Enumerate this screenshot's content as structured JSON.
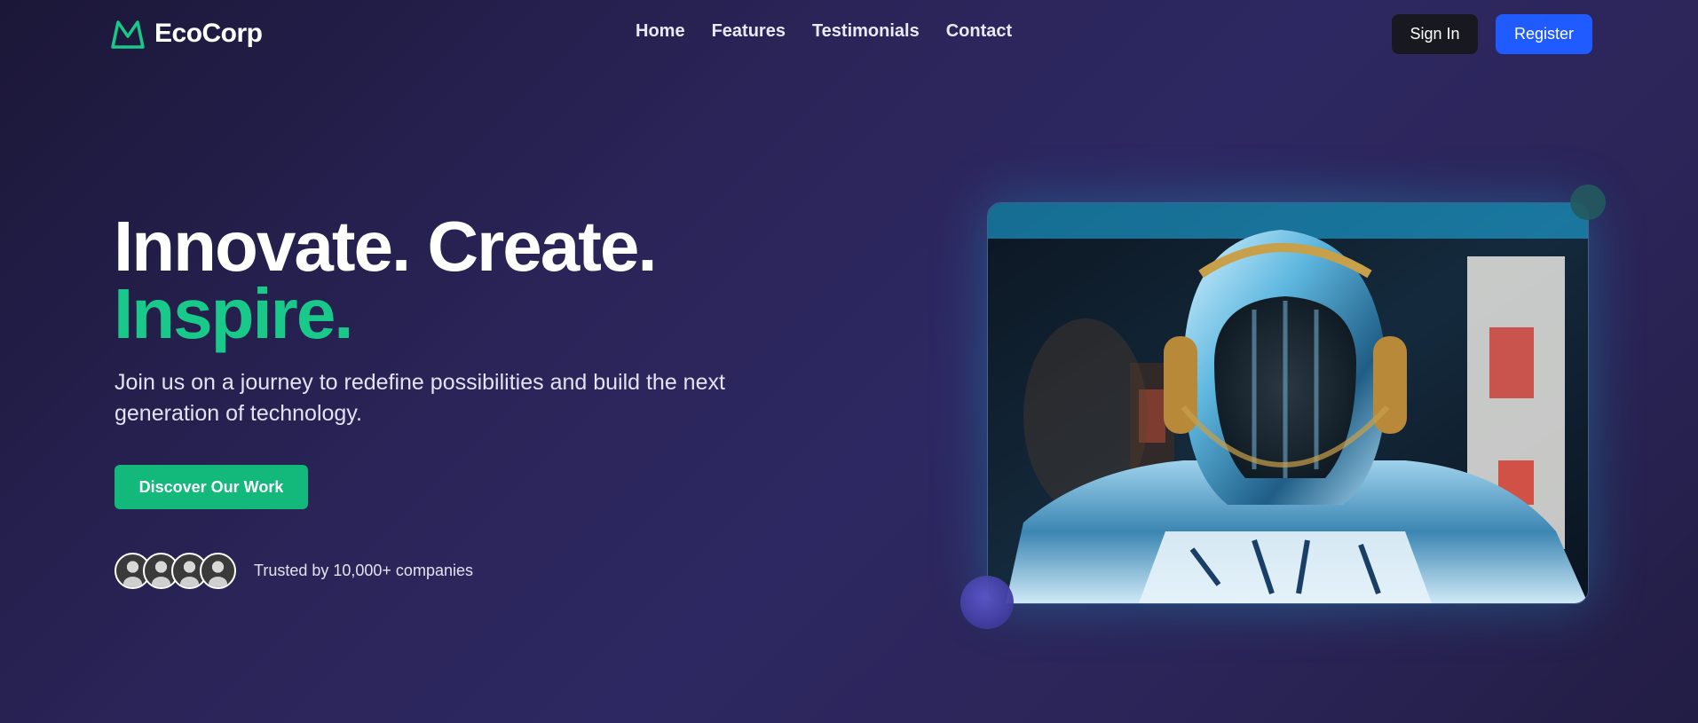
{
  "nav": {
    "brand": "EcoCorp",
    "logo_icon": "mountain-logo-icon",
    "links": [
      {
        "label": "Home"
      },
      {
        "label": "Features"
      },
      {
        "label": "Testimonials"
      },
      {
        "label": "Contact"
      }
    ],
    "sign_in_label": "Sign In",
    "register_label": "Register"
  },
  "hero": {
    "title_line1": "Innovate. Create.",
    "title_line2": "Inspire.",
    "subtitle": "Join us on a journey to redefine possibilities and build the next generation of technology.",
    "cta_label": "Discover Our Work",
    "trust_text": "Trusted by 10,000+ companies",
    "avatar_count": 4
  },
  "colors": {
    "accent_green": "#18c98a",
    "cta_green": "#12b97a",
    "register_blue": "#1f5bff",
    "signin_dark": "#181820",
    "background": "#2a2458"
  }
}
